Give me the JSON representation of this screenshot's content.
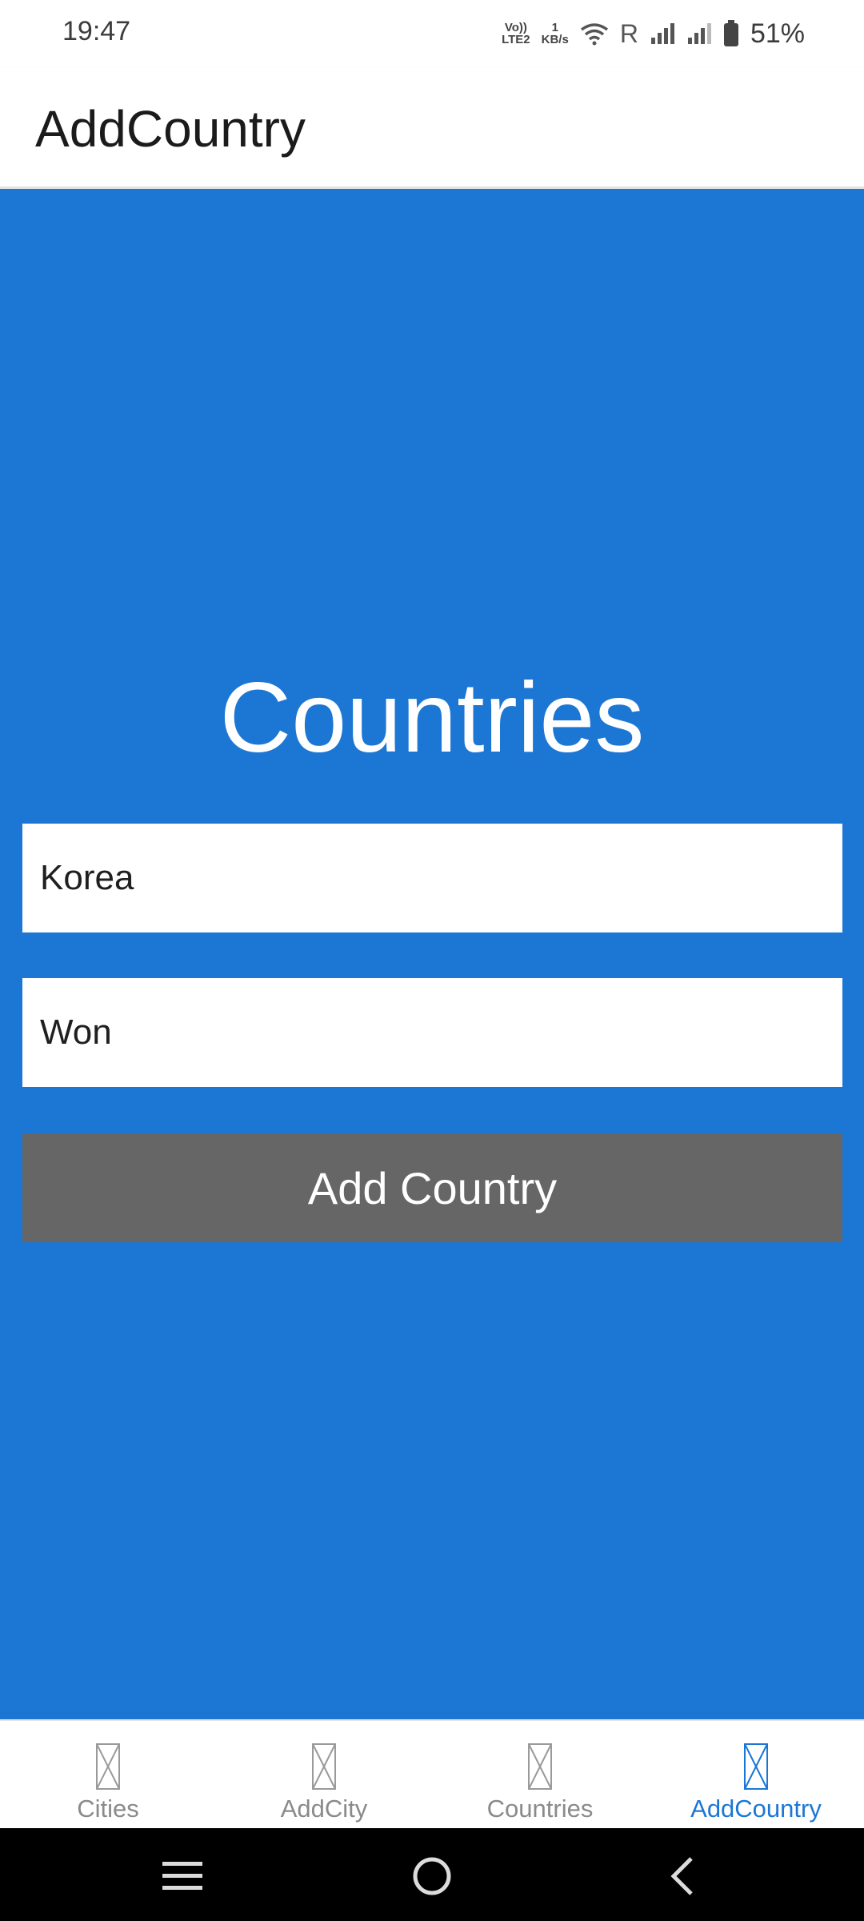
{
  "status_bar": {
    "time": "19:47",
    "volte_top": "Vo))",
    "volte_bottom": "LTE2",
    "speed_top": "1",
    "speed_bottom": "KB/s",
    "roaming": "R",
    "battery": "51%"
  },
  "app_bar": {
    "title": "AddCountry"
  },
  "main": {
    "heading": "Countries",
    "country_field": {
      "value": "Korea"
    },
    "currency_field": {
      "value": "Won"
    },
    "add_button_label": "Add Country",
    "background_color": "#1c77d4",
    "button_color": "#666666"
  },
  "tabs": [
    {
      "label": "Cities",
      "active": false
    },
    {
      "label": "AddCity",
      "active": false
    },
    {
      "label": "Countries",
      "active": false
    },
    {
      "label": "AddCountry",
      "active": true
    }
  ],
  "nav": {
    "icons": [
      "menu-icon",
      "home-icon",
      "back-icon"
    ]
  }
}
